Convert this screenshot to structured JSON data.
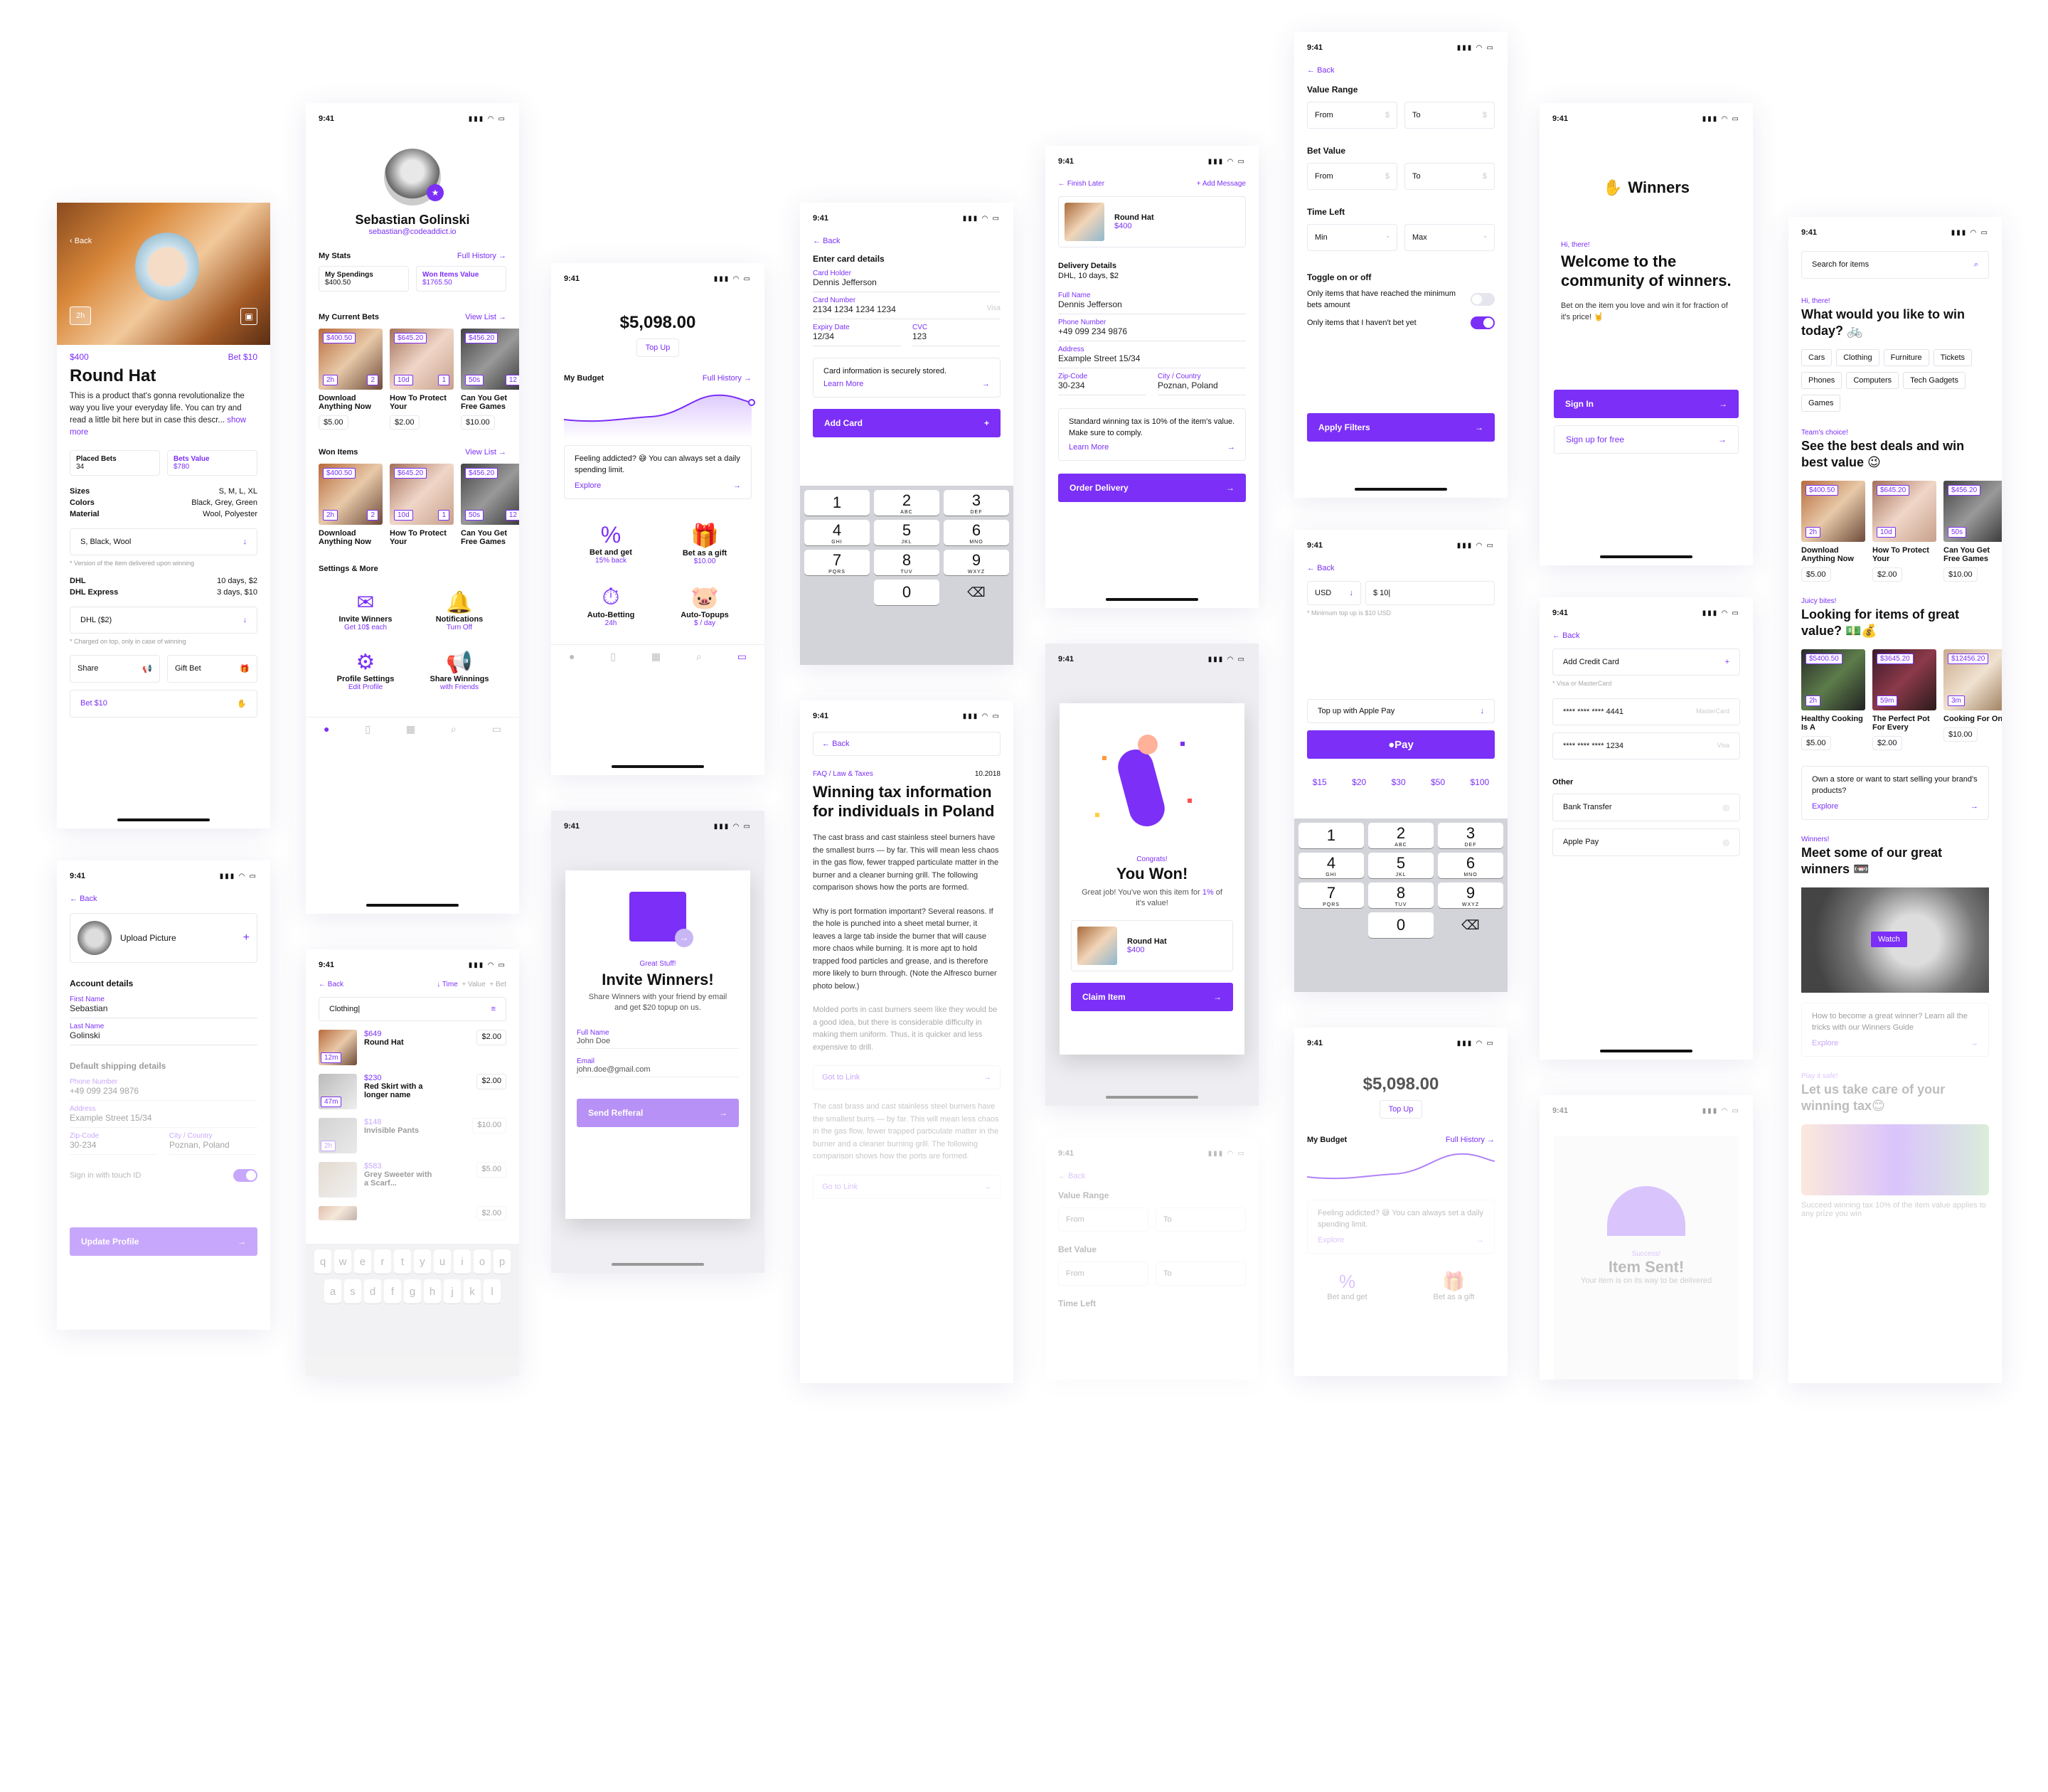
{
  "colors": {
    "accent": "#7b2ff7",
    "text": "#111111",
    "muted": "#555555"
  },
  "status": {
    "time": "9:41"
  },
  "common": {
    "back": "Back",
    "arrow": "→",
    "plus": "+",
    "chev": "↓"
  },
  "item_detail": {
    "back": "Back",
    "timer": "2h",
    "price": "$400",
    "bet_label": "Bet $10",
    "title": "Round Hat",
    "description": "This is a product that's gonna revolutionalize the way you live your everyday life. You can try and read a little bit here but in case this descr...",
    "show_more": "show more",
    "placed_bets_label": "Placed Bets",
    "placed_bets_value": "34",
    "bets_value_label": "Bets Value",
    "bets_value_value": "$780",
    "specs": [
      {
        "k": "Sizes",
        "v": "S, M, L, XL"
      },
      {
        "k": "Colors",
        "v": "Black, Grey, Green"
      },
      {
        "k": "Material",
        "v": "Wool, Polyester"
      }
    ],
    "variant_select": "S, Black, Wool",
    "variant_note": "* Version of the item delivered upon winning",
    "shipping": [
      {
        "k": "DHL",
        "v": "10 days, $2"
      },
      {
        "k": "DHL Express",
        "v": "3 days, $10"
      }
    ],
    "shipping_select": "DHL ($2)",
    "shipping_note": "* Charged on top, only in case of winning",
    "share": "Share",
    "gift_bet": "Gift Bet",
    "bet_button": "Bet $10"
  },
  "edit_profile": {
    "back": "Back",
    "upload": "Upload Picture",
    "account_title": "Account details",
    "fields": [
      {
        "label": "First Name",
        "value": "Sebastian"
      },
      {
        "label": "Last Name",
        "value": "Golinski"
      }
    ],
    "shipping_title": "Default shipping details",
    "ship_fields": [
      {
        "label": "Phone Number",
        "value": "+49 099 234 9876"
      },
      {
        "label": "Address",
        "value": "Example Street 15/34"
      }
    ],
    "zip_label": "Zip-Code",
    "zip_value": "30-234",
    "city_label": "City / Country",
    "city_value": "Poznan, Poland",
    "touch_id": "Sign in with touch ID",
    "update": "Update Profile"
  },
  "profile": {
    "name": "Sebastian Golinski",
    "email": "sebastian@codeaddict.io",
    "stats_title": "My Stats",
    "full_history": "Full History",
    "spend_label": "My Spendings",
    "spend_value": "$400.50",
    "won_label": "Won Items Value",
    "won_value": "$1765.50",
    "bets_title": "My Current Bets",
    "view_list": "View List",
    "bets": [
      {
        "tag": "$400.50",
        "time": "2h",
        "count": "2",
        "name": "Download Anything Now",
        "price": "$5.00"
      },
      {
        "tag": "$645.20",
        "time": "10d",
        "count": "1",
        "name": "How To Protect Your",
        "price": "$2.00"
      },
      {
        "tag": "$456.20",
        "time": "50s",
        "count": "12",
        "name": "Can You Get Free Games",
        "price": "$10.00"
      }
    ],
    "won_title": "Won Items",
    "won_view": "View List",
    "won": [
      {
        "tag": "$400.50",
        "time": "2h",
        "count": "2",
        "name": "Download Anything Now"
      },
      {
        "tag": "$645.20",
        "time": "10d",
        "count": "1",
        "name": "How To Protect Your"
      },
      {
        "tag": "$456.20",
        "time": "50s",
        "count": "12",
        "name": "Can You Get Free Games"
      }
    ],
    "settings_title": "Settings & More",
    "settings": [
      {
        "title": "Invite Winners",
        "sub": "Get 10$ each"
      },
      {
        "title": "Notifications",
        "sub": "Turn Off"
      },
      {
        "title": "Profile Settings",
        "sub": "Edit Profile"
      },
      {
        "title": "Share Winnings",
        "sub": "with Friends"
      }
    ]
  },
  "search_list": {
    "back": "Back",
    "sort_time": "Time",
    "sort_value": "Value",
    "sort_bet": "Bet",
    "query": "Clothing|",
    "items": [
      {
        "price": "$649",
        "name": "Round Hat",
        "bet": "$2.00",
        "time": "12m"
      },
      {
        "price": "$230",
        "name": "Red Skirt with a longer name",
        "bet": "$2.00",
        "time": "47m"
      },
      {
        "price": "$148",
        "name": "Invisible Pants",
        "bet": "$10.00",
        "time": "2h"
      },
      {
        "price": "$583",
        "name": "Grey Sweeter with a Scarf...",
        "bet": "$5.00",
        "time": ""
      },
      {
        "price": "",
        "name": "",
        "bet": "$2.00",
        "time": ""
      }
    ],
    "keys1": [
      "q",
      "w",
      "e",
      "r",
      "t",
      "y",
      "u",
      "i",
      "o",
      "p"
    ],
    "keys2": [
      "a",
      "s",
      "d",
      "f",
      "g",
      "h",
      "j",
      "k",
      "l"
    ]
  },
  "budget": {
    "amount": "$5,098.00",
    "topup": "Top Up",
    "title": "My Budget",
    "full_history": "Full History",
    "note": "Feeling addicted? 😅 You can always set a daily spending limit.",
    "explore": "Explore",
    "features": [
      {
        "title": "Bet and get",
        "sub": "15% back"
      },
      {
        "title": "Bet as a gift",
        "sub": "$10.00"
      },
      {
        "title": "Auto-Betting",
        "sub": "24h"
      },
      {
        "title": "Auto-Topups",
        "sub": "$ / day"
      }
    ]
  },
  "invite": {
    "kicker": "Great Stuff!",
    "title": "Invite Winners!",
    "desc": "Share Winners with your friend by email and get $20 topup on us.",
    "name_label": "Full Name",
    "name_value": "John Doe",
    "email_label": "Email",
    "email_value": "john.doe@gmail.com",
    "send": "Send Refferal"
  },
  "card": {
    "back": "Back",
    "title": "Enter card details",
    "holder_label": "Card Holder",
    "holder_value": "Dennis Jefferson",
    "number_label": "Card Number",
    "number_value": "2134 1234 1234 1234",
    "brand": "Visa",
    "exp_label": "Expiry Date",
    "exp_value": "12/34",
    "cvc_label": "CVC",
    "cvc_value": "123",
    "info": "Card information is securely stored.",
    "learn": "Learn More",
    "add": "Add Card",
    "keys": [
      {
        "n": "1",
        "l": ""
      },
      {
        "n": "2",
        "l": "ABC"
      },
      {
        "n": "3",
        "l": "DEF"
      },
      {
        "n": "4",
        "l": "GHI"
      },
      {
        "n": "5",
        "l": "JKL"
      },
      {
        "n": "6",
        "l": "MNO"
      },
      {
        "n": "7",
        "l": "PQRS"
      },
      {
        "n": "8",
        "l": "TUV"
      },
      {
        "n": "9",
        "l": "WXYZ"
      }
    ],
    "zero": "0"
  },
  "article": {
    "back": "Back",
    "category": "FAQ / Law & Taxes",
    "date": "10.2018",
    "title": "Winning tax information for individuals in Poland",
    "p1": "The cast brass and cast stainless steel burners have the smallest burrs — by far. This will mean less chaos in the gas flow, fewer trapped particulate matter in the burner and a cleaner burning grill. The following comparison shows how the ports are formed.",
    "p2": "Why is port formation important? Several reasons. If the hole is punched into a sheet metal burner, it leaves a large tab inside the burner that will cause more chaos while burning. It is more apt to hold trapped food particles and grease, and is therefore more likely to burn through. (Note the Alfresco burner photo below.)",
    "p3": "Molded ports in cast burners seem like they would be a good idea, but there is considerable difficulty in making them uniform. Thus, it is quicker and less expensive to drill.",
    "link": "Got to Link",
    "p4": "The cast brass and cast stainless steel burners have the smallest burrs — by far. This will mean less chaos in the gas flow, fewer trapped particulate matter in the burner and a cleaner burning grill. The following comparison shows how the ports are formed.",
    "link2": "Go to Link"
  },
  "delivery": {
    "finish_later": "Finish Later",
    "add_message": "Add Message",
    "item_name": "Round Hat",
    "item_price": "$400",
    "details_title": "Delivery Details",
    "details_value": "DHL, 10 days, $2",
    "fields": [
      {
        "label": "Full Name",
        "value": "Dennis Jefferson"
      },
      {
        "label": "Phone Number",
        "value": "+49 099 234 9876"
      },
      {
        "label": "Address",
        "value": "Example Street 15/34"
      }
    ],
    "zip_label": "Zip-Code",
    "zip_value": "30-234",
    "city_label": "City / Country",
    "city_value": "Poznan, Poland",
    "note": "Standard winning tax is 10% of the item's value. Make sure to comply.",
    "learn": "Learn More",
    "order": "Order Delivery"
  },
  "won": {
    "kicker": "Congrats!",
    "title": "You Won!",
    "desc": "Great job! You've won this item for",
    "pct": "1%",
    "desc2": "of it's value!",
    "item_name": "Round Hat",
    "item_price": "$400",
    "claim": "Claim Item"
  },
  "filters": {
    "back": "Back",
    "value_range": "Value Range",
    "from": "From",
    "to": "To",
    "bet_value": "Bet Value",
    "time_left": "Time Left",
    "min": "Min",
    "max": "Max",
    "toggle_title": "Toggle on or off",
    "opt1": "Only items that have reached the minimum bets amount",
    "opt2": "Only items that I haven't bet yet",
    "apply": "Apply Filters"
  },
  "topup": {
    "back": "Back",
    "currency": "USD",
    "amount": "$ 10|",
    "note": "* Minimum top up is $10 USD",
    "method": "Top up with Apple Pay",
    "pay": " Pay",
    "quick": [
      "$15",
      "$20",
      "$30",
      "$50",
      "$100"
    ]
  },
  "welcome": {
    "brand": "Winners",
    "kicker": "Hi, there!",
    "title": "Welcome to the community of winners.",
    "desc": "Bet on the item you love and win it for fraction of it's price! 🤘",
    "signin": "Sign In",
    "signup": "Sign up for free"
  },
  "payment": {
    "back": "Back",
    "add_card": "Add Credit Card",
    "note": "* Visa or MasterCard",
    "cards": [
      {
        "num": "**** **** **** 4441",
        "brand": "MasterCard"
      },
      {
        "num": "**** **** **** 1234",
        "brand": "Visa"
      }
    ],
    "other": "Other",
    "methods": [
      "Bank Transfer",
      "Apple Pay"
    ]
  },
  "item_sent": {
    "kicker": "Success!",
    "title": "Item Sent!",
    "desc": "Your item is on its way to be delivered"
  },
  "home": {
    "search": "Search for items",
    "kicker": "Hi, there!",
    "title": "What would you like to win today? 🚲",
    "chips": [
      "Cars",
      "Clothing",
      "Furniture",
      "Tickets",
      "Phones",
      "Computers",
      "Tech Gadgets",
      "Games"
    ],
    "s1_kicker": "Team's choice!",
    "s1_title": "See the best deals and win best value 😉",
    "s1_items": [
      {
        "tag": "$400.50",
        "time": "2h",
        "name": "Download Anything Now",
        "price": "$5.00"
      },
      {
        "tag": "$645.20",
        "time": "10d",
        "name": "How To Protect Your",
        "price": "$2.00"
      },
      {
        "tag": "$456.20",
        "time": "50s",
        "name": "Can You Get Free Games",
        "price": "$10.00"
      }
    ],
    "s2_kicker": "Juicy bites!",
    "s2_title": "Looking for items of great value? 💵💰",
    "s2_items": [
      {
        "tag": "$5400.50",
        "time": "2h",
        "name": "Healthy Cooking Is A",
        "price": "$5.00"
      },
      {
        "tag": "$3645.20",
        "time": "59m",
        "name": "The Perfect Pot For Every",
        "price": "$2.00"
      },
      {
        "tag": "$12456.20",
        "time": "3m",
        "name": "Cooking For One",
        "price": "$10.00"
      }
    ],
    "store": "Own a store or want to start selling your brand's products?",
    "explore": "Explore",
    "s3_kicker": "Winners!",
    "s3_title": "Meet some of our great winners 📼",
    "watch": "Watch",
    "guide": "How to become a great winner? Learn all the tricks with our Winners Guide",
    "explore2": "Explore",
    "s4_kicker": "Play it safe!",
    "s4_title": "Let us take care of your winning tax😊",
    "s4_desc": "Succeed winning tax 10% of the item value applies to any prize you win"
  }
}
